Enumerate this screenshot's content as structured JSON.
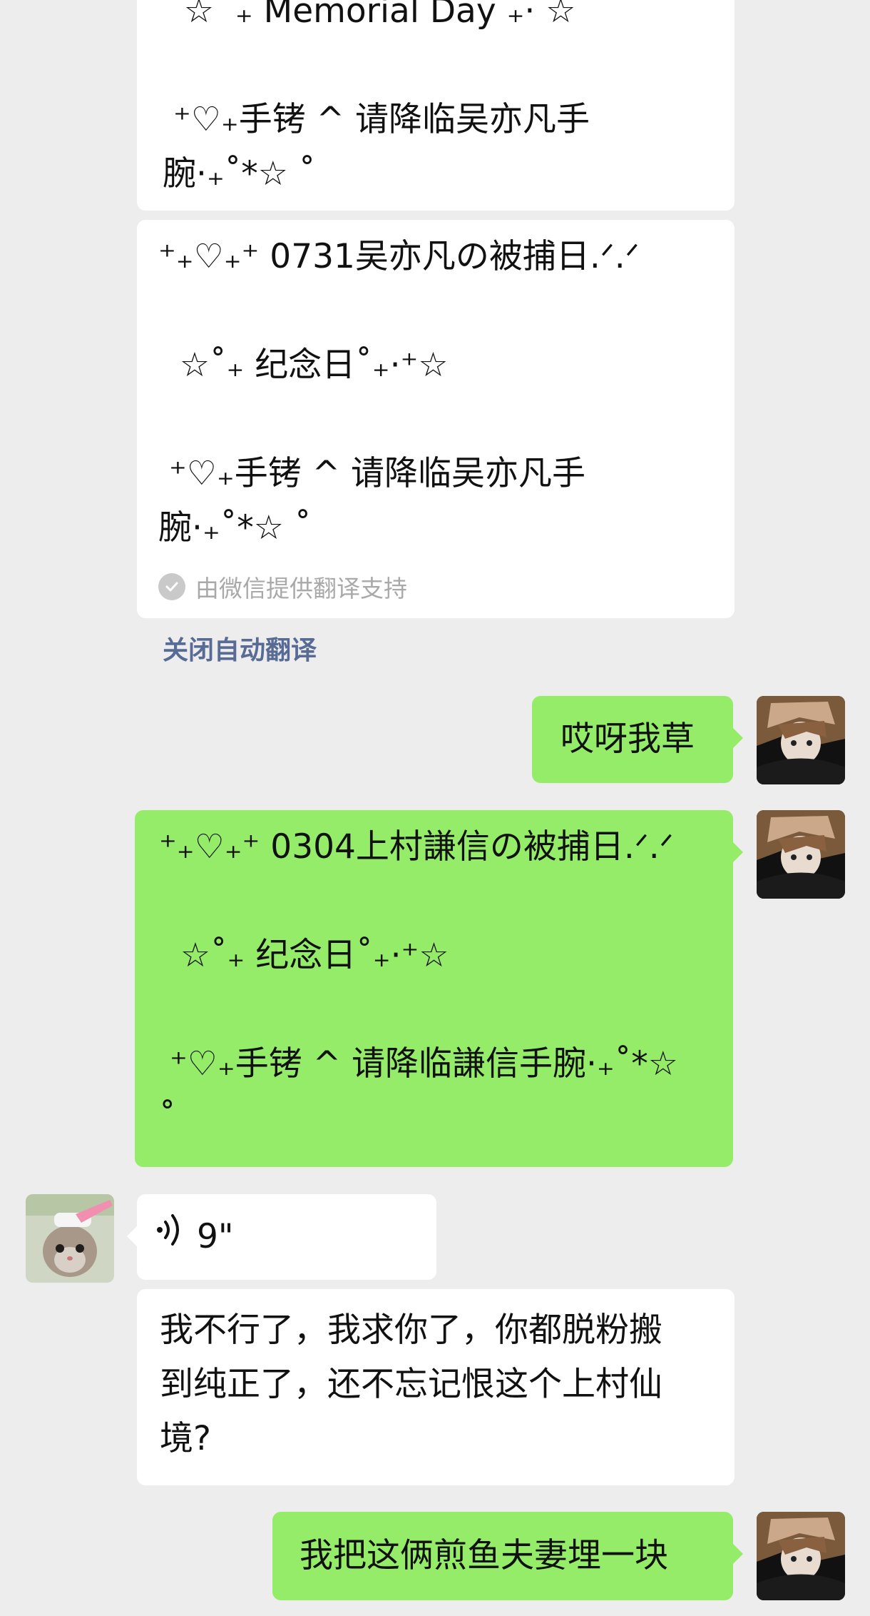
{
  "messages": {
    "m1_lines": [
      "  ☆  ₊ Memorial Day ₊· ☆",
      "",
      " ⁺♡₊手铐 ^ 请降临吴亦凡手",
      "腕·₊˚*☆ ˚"
    ],
    "m2_lines": [
      "⁺₊♡₊⁺ 0731吴亦凡の被捕日.ᐟ.ᐟ",
      "",
      "  ☆˚₊ 纪念日˚₊·⁺☆",
      "",
      " ⁺♡₊手铐 ^ 请降临吴亦凡手",
      "腕·₊˚*☆ ˚"
    ],
    "translate_note": "由微信提供翻译支持",
    "close_translate": "关闭自动翻译",
    "m3": "哎呀我草",
    "m4_lines": [
      "⁺₊♡₊⁺ 0304上村謙信の被捕日.ᐟ.ᐟ",
      "",
      "  ☆˚₊ 纪念日˚₊·⁺☆",
      "",
      " ⁺♡₊手铐 ^ 请降临謙信手腕·₊˚*☆",
      "˚"
    ],
    "voice_duration": "9\"",
    "m6_lines": [
      "我不行了，我求你了，你都脱粉搬",
      "到纯正了，还不忘记恨这个上村仙",
      "境?"
    ],
    "m7": "我把这俩煎鱼夫妻埋一块"
  },
  "icons": {
    "check": "check-circle-icon",
    "voice": "voice-wave-icon"
  },
  "colors": {
    "background": "#ededed",
    "bubble_self": "#95ec69",
    "bubble_other": "#ffffff",
    "link": "#576b95"
  }
}
